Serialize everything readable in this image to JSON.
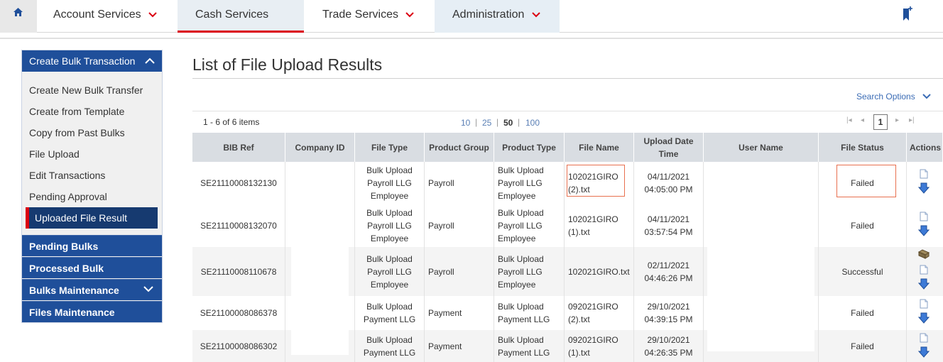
{
  "nav": {
    "tabs": [
      {
        "label": "Account Services"
      },
      {
        "label": "Cash Services"
      },
      {
        "label": "Trade Services"
      },
      {
        "label": "Administration"
      }
    ]
  },
  "sidebar": {
    "header": "Create Bulk Transaction",
    "items": [
      "Create New Bulk Transfer",
      "Create from Template",
      "Copy from Past Bulks",
      "File Upload",
      "Edit Transactions",
      "Pending Approval"
    ],
    "active": "Uploaded File Result",
    "sections": [
      "Pending Bulks",
      "Processed Bulk",
      "Bulks Maintenance",
      "Files Maintenance"
    ]
  },
  "page": {
    "title": "List of File Upload Results",
    "search_options": "Search Options",
    "count": "1 - 6 of 6 items",
    "page_sizes": [
      "10",
      "25",
      "50",
      "100"
    ],
    "current_page": "1"
  },
  "table": {
    "headers": [
      "BIB Ref",
      "Company ID",
      "File Type",
      "Product Group",
      "Product Type",
      "File Name",
      "Upload Date Time",
      "User Name",
      "File Status",
      "Actions"
    ],
    "rows": [
      {
        "bib": "SE21110008132130",
        "file_type": [
          "Bulk Upload",
          "Payroll LLG",
          "Employee"
        ],
        "group": "Payroll",
        "ptype": [
          "Bulk Upload",
          "Payroll LLG",
          "Employee"
        ],
        "fname": [
          "102021GIRO",
          "(2).txt"
        ],
        "date": "04/11/2021",
        "time": "04:05:00 PM",
        "status": "Failed"
      },
      {
        "bib": "SE21110008132070",
        "file_type": [
          "Bulk Upload",
          "Payroll LLG",
          "Employee"
        ],
        "group": "Payroll",
        "ptype": [
          "Bulk Upload",
          "Payroll LLG",
          "Employee"
        ],
        "fname": [
          "102021GIRO",
          "(1).txt"
        ],
        "date": "04/11/2021",
        "time": "03:57:54 PM",
        "status": "Failed"
      },
      {
        "bib": "SE21110008110678",
        "file_type": [
          "Bulk Upload",
          "Payroll LLG",
          "Employee"
        ],
        "group": "Payroll",
        "ptype": [
          "Bulk Upload",
          "Payroll LLG",
          "Employee"
        ],
        "fname": [
          "102021GIRO.txt"
        ],
        "date": "02/11/2021",
        "time": "04:46:26 PM",
        "status": "Successful"
      },
      {
        "bib": "SE21100008086378",
        "file_type": [
          "Bulk Upload",
          "Payment LLG"
        ],
        "group": "Payment",
        "ptype": [
          "Bulk Upload",
          "Payment LLG"
        ],
        "fname": [
          "092021GIRO",
          "(2).txt"
        ],
        "date": "29/10/2021",
        "time": "04:39:15 PM",
        "status": "Failed"
      },
      {
        "bib": "SE21100008086302",
        "file_type": [
          "Bulk Upload",
          "Payment LLG"
        ],
        "group": "Payment",
        "ptype": [
          "Bulk Upload",
          "Payment LLG"
        ],
        "fname": [
          "092021GIRO",
          "(1).txt"
        ],
        "date": "29/10/2021",
        "time": "04:26:35 PM",
        "status": "Failed"
      }
    ]
  },
  "colors": {
    "brand_blue": "#1f4f9a",
    "accent_red": "#db0011",
    "link": "#3b6cb5"
  }
}
